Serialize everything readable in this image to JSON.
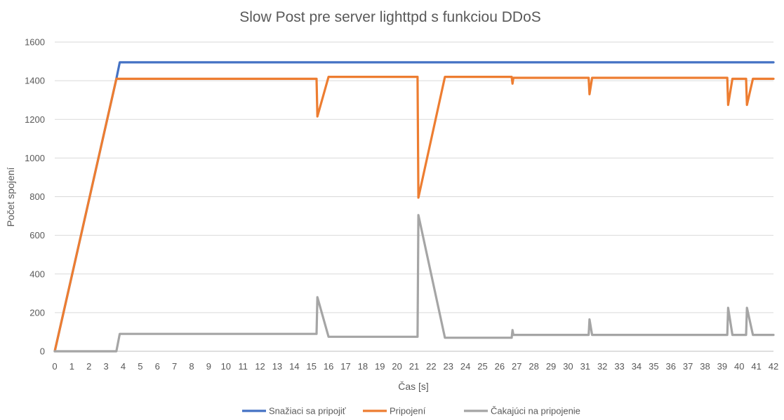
{
  "chart_data": {
    "type": "line",
    "title": "Slow Post pre server lighttpd s funkciou DDoS",
    "xlabel": "Čas [s]",
    "ylabel": "Počet spojení",
    "xlim": [
      0,
      42
    ],
    "ylim": [
      0,
      1600
    ],
    "x_ticks": [
      0,
      1,
      2,
      3,
      4,
      5,
      6,
      7,
      8,
      9,
      10,
      11,
      12,
      13,
      14,
      15,
      16,
      17,
      18,
      19,
      20,
      21,
      22,
      23,
      24,
      25,
      26,
      27,
      28,
      29,
      30,
      31,
      32,
      33,
      34,
      35,
      36,
      37,
      38,
      39,
      40,
      41,
      42
    ],
    "x_tick_labels": [
      "0",
      "1",
      "2",
      "3",
      "4",
      "5",
      "6",
      "7",
      "8",
      "9",
      "10",
      "11",
      "12",
      "13",
      "14",
      "15",
      "16",
      "17",
      "18",
      "19",
      "20",
      "21",
      "22",
      "23",
      "24",
      "25",
      "26",
      "27",
      "28",
      "29",
      "30",
      "31",
      "32",
      "33",
      "34",
      "35",
      "36",
      "37",
      "38",
      "39",
      "40",
      "41",
      "42"
    ],
    "y_ticks": [
      0,
      200,
      400,
      600,
      800,
      1000,
      1200,
      1400,
      1600
    ],
    "y_tick_labels": [
      "0",
      "200",
      "400",
      "600",
      "800",
      "1000",
      "1200",
      "1400",
      "1600"
    ],
    "grid": "horizontal",
    "legend_position": "bottom",
    "series": [
      {
        "name": "Snažiaci sa pripojiť",
        "color": "#4472C4",
        "points": [
          [
            0,
            0
          ],
          [
            3.6,
            1410
          ],
          [
            3.8,
            1495
          ],
          [
            42,
            1495
          ]
        ]
      },
      {
        "name": "Pripojení",
        "color": "#ED7D31",
        "points": [
          [
            0,
            0
          ],
          [
            3.6,
            1410
          ],
          [
            15.3,
            1410
          ],
          [
            15.35,
            1215
          ],
          [
            16.0,
            1420
          ],
          [
            21.2,
            1420
          ],
          [
            21.25,
            795
          ],
          [
            22.8,
            1420
          ],
          [
            26.7,
            1420
          ],
          [
            26.75,
            1385
          ],
          [
            26.8,
            1415
          ],
          [
            31.2,
            1415
          ],
          [
            31.25,
            1330
          ],
          [
            31.4,
            1415
          ],
          [
            39.3,
            1415
          ],
          [
            39.35,
            1275
          ],
          [
            39.6,
            1410
          ],
          [
            40.4,
            1410
          ],
          [
            40.45,
            1275
          ],
          [
            40.8,
            1410
          ],
          [
            42,
            1410
          ]
        ]
      },
      {
        "name": "Čakajúci na pripojenie",
        "color": "#A5A5A5",
        "points": [
          [
            0,
            0
          ],
          [
            3.6,
            0
          ],
          [
            3.8,
            90
          ],
          [
            15.3,
            90
          ],
          [
            15.35,
            280
          ],
          [
            16.0,
            75
          ],
          [
            21.2,
            75
          ],
          [
            21.25,
            705
          ],
          [
            22.8,
            70
          ],
          [
            26.7,
            70
          ],
          [
            26.75,
            110
          ],
          [
            26.8,
            85
          ],
          [
            31.2,
            85
          ],
          [
            31.25,
            165
          ],
          [
            31.4,
            85
          ],
          [
            39.3,
            85
          ],
          [
            39.35,
            225
          ],
          [
            39.6,
            85
          ],
          [
            40.4,
            85
          ],
          [
            40.45,
            225
          ],
          [
            40.8,
            85
          ],
          [
            42,
            85
          ]
        ]
      }
    ]
  }
}
